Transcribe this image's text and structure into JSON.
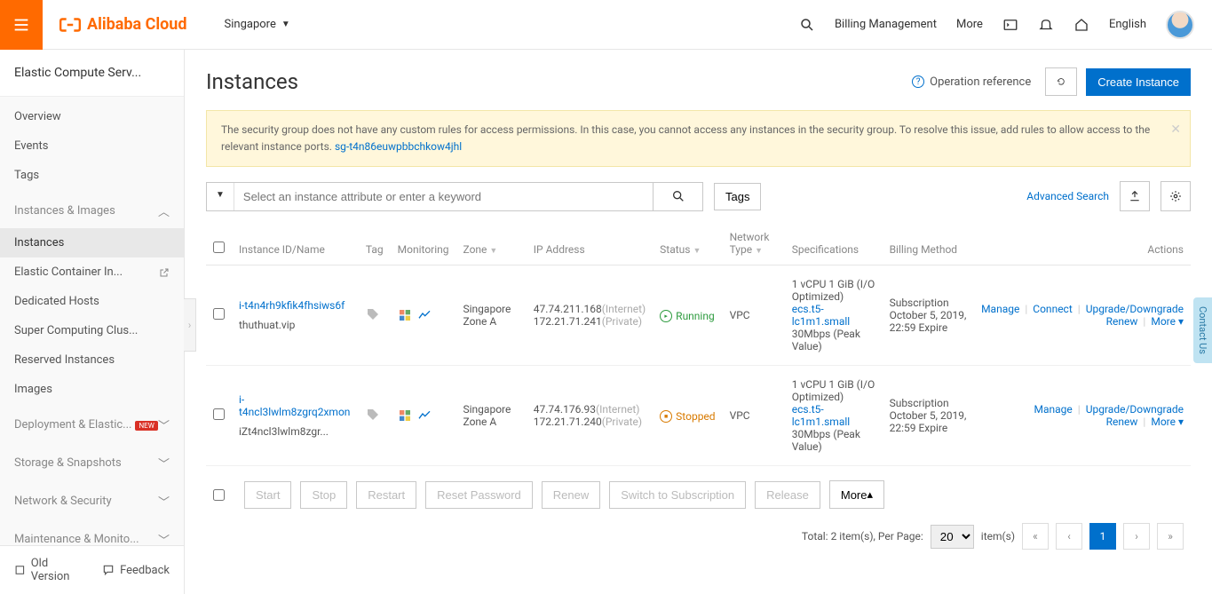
{
  "brand": "Alibaba Cloud",
  "region": "Singapore",
  "top": {
    "billing": "Billing Management",
    "more": "More",
    "language": "English"
  },
  "sidebar": {
    "title": "Elastic Compute Serv...",
    "items": {
      "overview": "Overview",
      "events": "Events",
      "tags": "Tags",
      "instancesImages": "Instances & Images",
      "instances": "Instances",
      "elasticContainer": "Elastic Container In...",
      "dedicatedHosts": "Dedicated Hosts",
      "superComputing": "Super Computing Clus...",
      "reserved": "Reserved Instances",
      "images": "Images",
      "deployment": "Deployment & Elastic...",
      "storage": "Storage & Snapshots",
      "network": "Network & Security",
      "maintenance": "Maintenance & Monito...",
      "new": "NEW"
    },
    "footer": {
      "old": "Old Version",
      "feedback": "Feedback"
    }
  },
  "page": {
    "title": "Instances",
    "opRef": "Operation reference",
    "create": "Create Instance"
  },
  "alert": {
    "text": "The security group does not have any custom rules for access permissions. In this case, you cannot access any instances in the security group. To resolve this issue, add rules to allow access to the relevant instance ports. ",
    "link": "sg-t4n86euwpbbchkow4jhl"
  },
  "toolbar": {
    "placeholder": "Select an instance attribute or enter a keyword",
    "tags": "Tags",
    "advanced": "Advanced Search"
  },
  "columns": {
    "idName": "Instance ID/Name",
    "tag": "Tag",
    "monitoring": "Monitoring",
    "zone": "Zone",
    "ip": "IP Address",
    "status": "Status",
    "network": "Network Type",
    "specs": "Specifications",
    "billing": "Billing Method",
    "actions": "Actions"
  },
  "rows": [
    {
      "id": "i-t4n4rh9kfik4fhsiws6f",
      "name": "thuthuat.vip",
      "zone": "Singapore Zone A",
      "ipPublic": "47.74.211.168",
      "ipPublicLabel": "(Internet)",
      "ipPrivate": "172.21.71.241",
      "ipPrivateLabel": "(Private)",
      "status": "Running",
      "network": "VPC",
      "spec1": "1 vCPU 1 GiB (I/O Optimized)",
      "specLink": "ecs.t5-lc1m1.small",
      "spec2": "30Mbps (Peak Value)",
      "bill1": "Subscription",
      "bill2": "October 5, 2019, 22:59 Expire",
      "actions": {
        "manage": "Manage",
        "connect": "Connect",
        "upgrade": "Upgrade/Downgrade",
        "renew": "Renew",
        "more": "More"
      }
    },
    {
      "id": "i-t4ncl3lwlm8zgrq2xmon",
      "name": "iZt4ncl3lwlm8zgr...",
      "zone": "Singapore Zone A",
      "ipPublic": "47.74.176.93",
      "ipPublicLabel": "(Internet)",
      "ipPrivate": "172.21.71.240",
      "ipPrivateLabel": "(Private)",
      "status": "Stopped",
      "network": "VPC",
      "spec1": "1 vCPU 1 GiB (I/O Optimized)",
      "specLink": "ecs.t5-lc1m1.small",
      "spec2": "30Mbps (Peak Value)",
      "bill1": "Subscription",
      "bill2": "October 5, 2019, 22:59 Expire",
      "actions": {
        "manage": "Manage",
        "upgrade": "Upgrade/Downgrade",
        "renew": "Renew",
        "more": "More"
      }
    }
  ],
  "bulk": {
    "start": "Start",
    "stop": "Stop",
    "restart": "Restart",
    "reset": "Reset Password",
    "renew": "Renew",
    "switch": "Switch to Subscription",
    "release": "Release",
    "more": "More"
  },
  "pagination": {
    "total": "Total: 2 item(s), Per Page:",
    "itemsLabel": "item(s)",
    "perPage": "20",
    "current": "1"
  },
  "contactUs": "Contact Us"
}
